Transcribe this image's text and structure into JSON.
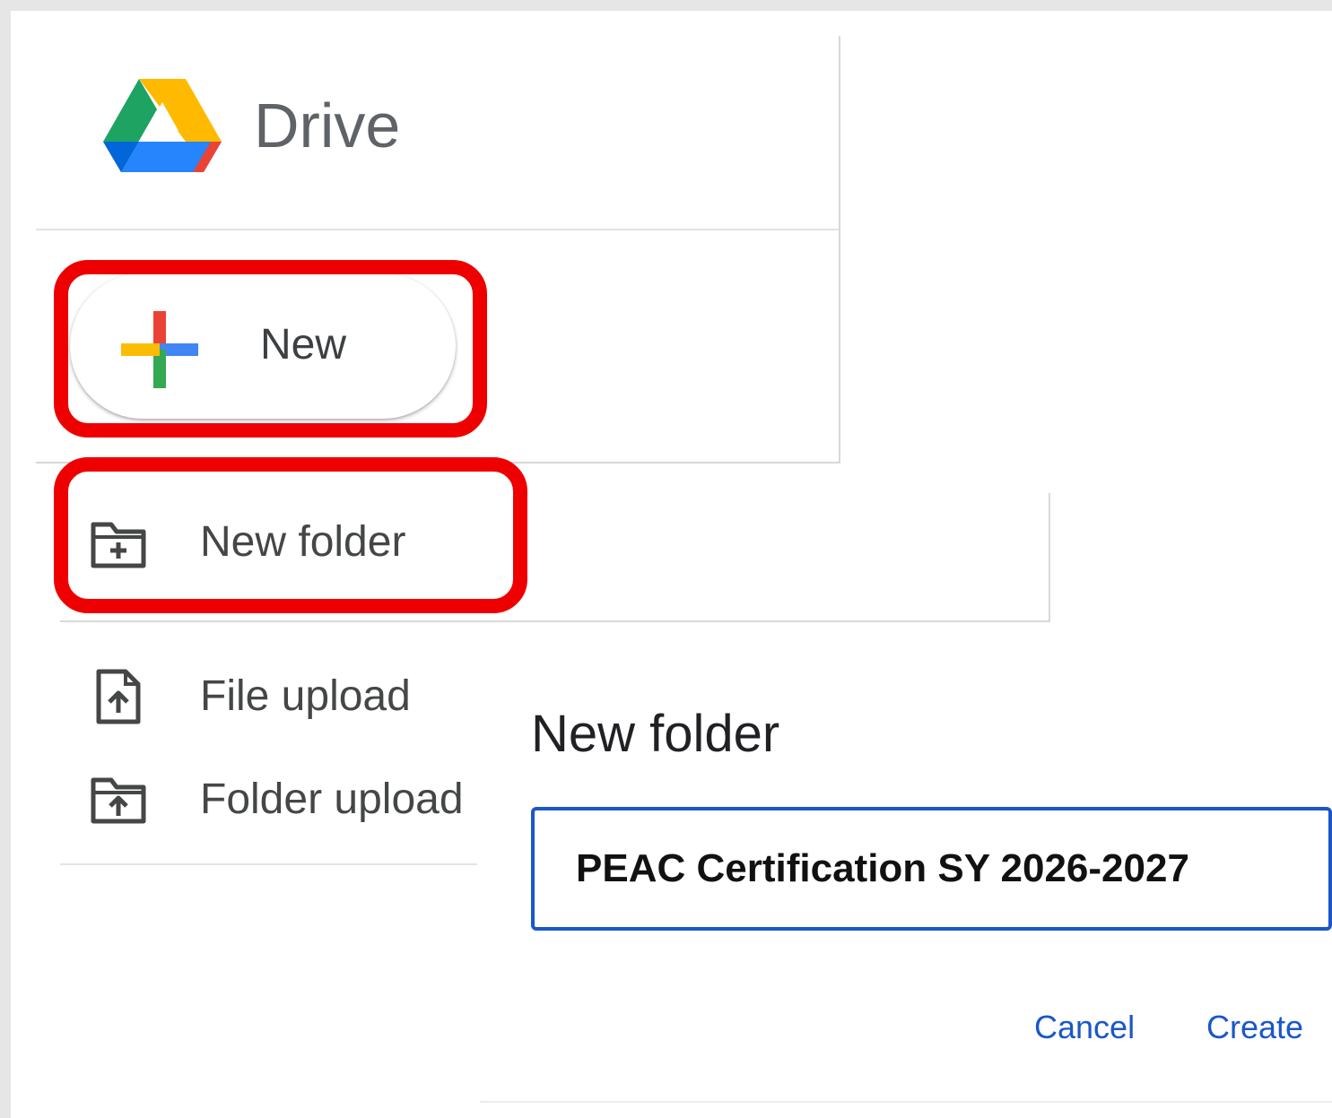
{
  "app": {
    "title": "Drive",
    "logo_icon": "google-drive-logo-icon"
  },
  "new_button": {
    "label": "New",
    "icon": "multicolor-plus-icon"
  },
  "menu": {
    "items": [
      {
        "label": "New folder",
        "icon": "folder-plus-icon",
        "highlighted": true
      },
      {
        "label": "File upload",
        "icon": "file-upload-icon",
        "highlighted": false
      },
      {
        "label": "Folder upload",
        "icon": "folder-upload-icon",
        "highlighted": false
      }
    ]
  },
  "dialog": {
    "title": "New folder",
    "input_value": "PEAC Certification SY 2026-2027",
    "cancel_label": "Cancel",
    "create_label": "Create"
  },
  "colors": {
    "highlight": "#ee0000",
    "accent": "#1a57c9",
    "text": "#3c4043"
  }
}
